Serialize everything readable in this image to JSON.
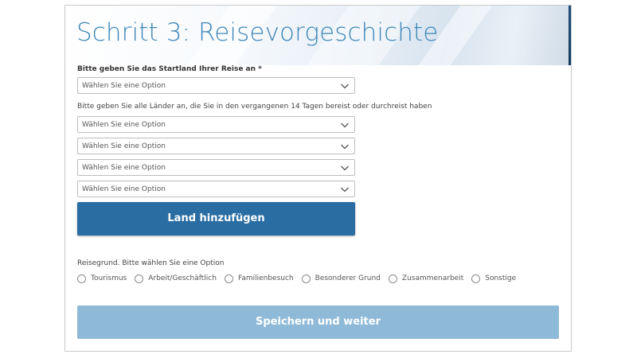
{
  "header": {
    "title": "Schritt 3: Reisevorgeschichte",
    "accent_color": "#3e86b8"
  },
  "start_country": {
    "label": "Bitte geben Sie das Startland Ihrer Reise an *",
    "select_value": "Wählen Sie eine Option"
  },
  "visited_countries": {
    "label": "Bitte geben Sie alle Länder an, die Sie in den vergangenen 14 Tagen bereist oder durchreist haben",
    "selects": [
      {
        "value": "Wählen Sie eine Option"
      },
      {
        "value": "Wählen Sie eine Option"
      },
      {
        "value": "Wählen Sie eine Option"
      },
      {
        "value": "Wählen Sie eine Option"
      }
    ],
    "add_button_label": "Land hinzufügen",
    "add_button_color": "#2a6da3"
  },
  "travel_reason": {
    "label": "Reisegrund. Bitte wählen Sie eine Option",
    "options": [
      {
        "label": "Tourismus",
        "selected": false
      },
      {
        "label": "Arbeit/Geschäftlich",
        "selected": false
      },
      {
        "label": "Familienbesuch",
        "selected": false
      },
      {
        "label": "Besonderer Grund",
        "selected": false
      },
      {
        "label": "Zusammenarbeit",
        "selected": false
      },
      {
        "label": "Sonstige",
        "selected": false
      }
    ]
  },
  "footer": {
    "save_button_label": "Speichern und weiter",
    "save_button_color": "#8ebad8",
    "save_button_enabled": false
  }
}
